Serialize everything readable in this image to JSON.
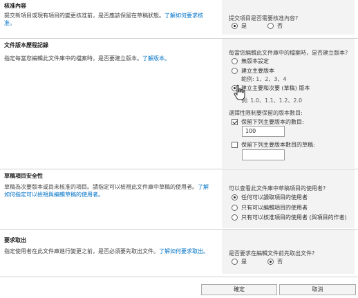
{
  "approval": {
    "title": "核准內容",
    "desc": "提交新項目或現有項目的變更核准前，是否應該保留在草稿狀態。",
    "link": "了解如何要求核准。",
    "question": "提交項目是否需要核准內容?",
    "options": [
      "是",
      "否"
    ],
    "selected": "是"
  },
  "versioning": {
    "title": "文件版本歷程記錄",
    "desc": "指定每當您編輯此文件庫中的檔案時，是否要建立版本。",
    "link": "了解版本。",
    "question": "每當您編輯此文件庫中的檔案時，是否建立版本?",
    "opt_none": "無版本設定",
    "opt_major": "建立主要版本",
    "opt_major_example": "範例: 1、2、3、4",
    "opt_minor": "建立主要和次要 (草稿) 版本",
    "opt_minor_example": "例: 1.0、1.1、1.2、2.0",
    "selected": "建立主要和次要 (草稿) 版本",
    "limit_label": "選擇性限制要保留的版本數目:",
    "keep_major_label": "保留下列主要版本的數目:",
    "keep_major_checked": true,
    "keep_major_value": "100",
    "keep_drafts_label": "保留下列主要版本數目的草稿:",
    "keep_drafts_checked": false,
    "keep_drafts_value": ""
  },
  "draft_security": {
    "title": "草稿項目安全性",
    "desc": "草稿為次要版本或尚未核准的項目。請指定可以檢視此文件庫中草稿的使用者。",
    "link": "了解如何指定可以檢視與編輯草稿的使用者。",
    "question": "可以查看此文件庫中草稿項目的使用者?",
    "options": [
      "任何可以讀取項目的使用者",
      "只有可以編輯項目的使用者",
      "只有可以核准項目的使用者 (與項目的作者)"
    ],
    "selected": "任何可以讀取項目的使用者"
  },
  "checkout": {
    "title": "要求取出",
    "desc": "指定使用者在此文件庫進行變更之前，是否必須要先取出文件。",
    "link": "了解如何要求取出。",
    "question": "是否要求在編輯文件前先取出文件?",
    "options": [
      "是",
      "否"
    ],
    "selected": "否"
  },
  "footer": {
    "ok_label": "確定",
    "cancel_label": "取消"
  }
}
